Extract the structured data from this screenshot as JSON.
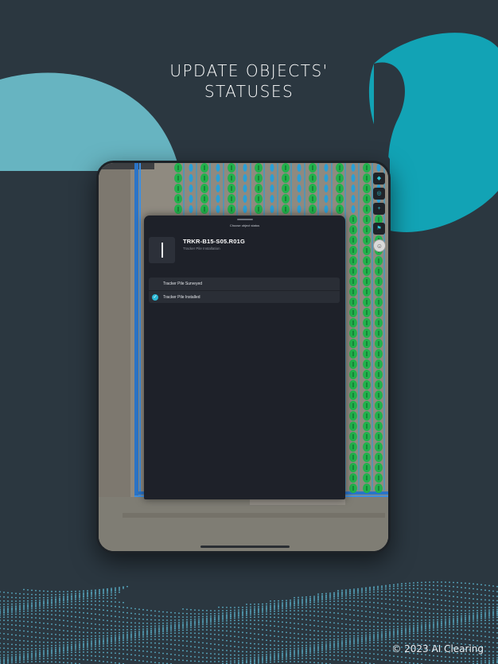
{
  "headline": {
    "line1": "UPDATE OBJECTS'",
    "line2": "STATUSES"
  },
  "copyright": "© 2023 AI Clearing",
  "colors": {
    "background": "#2b3740",
    "wave_teal": "#67b4c1",
    "wave_cyan": "#12a3b5",
    "dots": "#5bb0c9",
    "installed_marker": "#22b24c",
    "surveyed_marker": "#2a9fd6",
    "fence_line": "#2b74c7",
    "sheet_bg": "#1e2129",
    "check_accent": "#2ab7d4"
  },
  "sheet": {
    "title": "Choose object status",
    "object_name": "TRKR-B15-S05.R01G",
    "object_type": "Tracker Pile Installation",
    "object_icon": "pile-icon",
    "statuses": [
      {
        "label": "Tracker Pile Surveyed",
        "selected": false
      },
      {
        "label": "Tracker Pile Installed",
        "selected": true
      }
    ]
  },
  "toolbar": {
    "icons": [
      "layers-icon",
      "locate-icon",
      "zoom-icon",
      "flag-icon",
      "avatar-icon"
    ]
  }
}
